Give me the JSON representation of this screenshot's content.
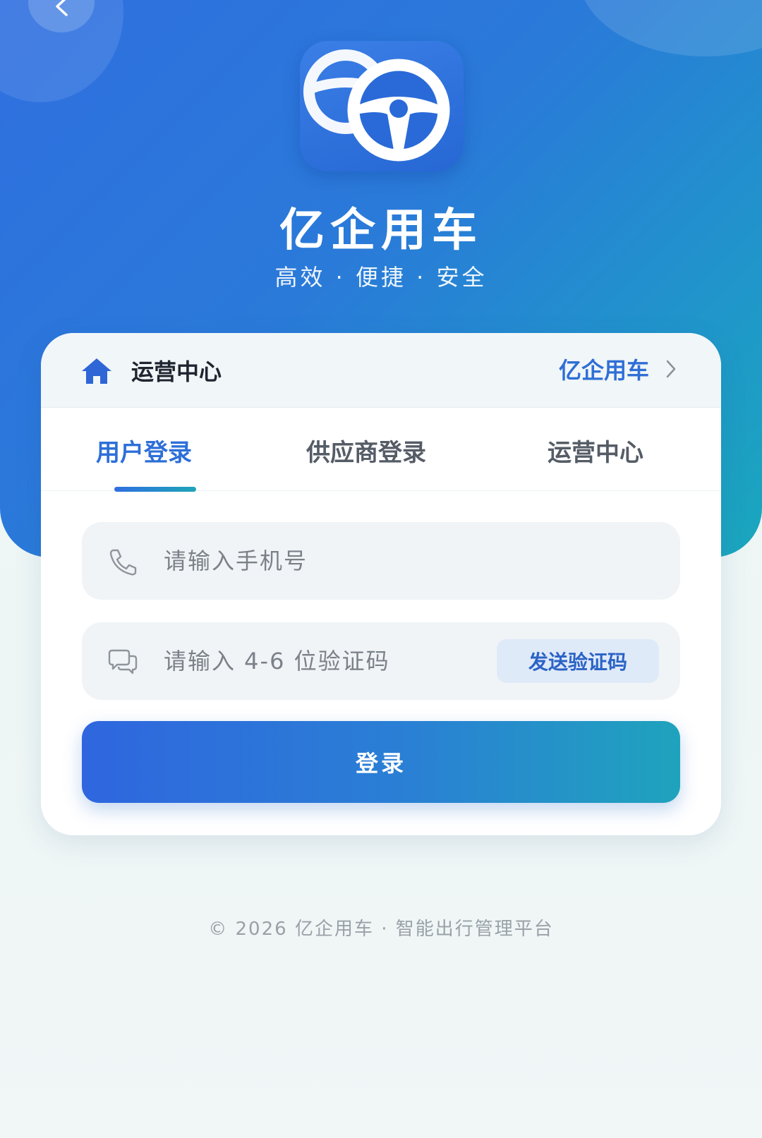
{
  "app": {
    "title": "亿企用车",
    "slogan": "高效 · 便捷 · 安全",
    "icon": "steering-wheel-icon"
  },
  "header": {
    "title": "运营中心",
    "link_label": "亿企用车",
    "home_icon": "home-icon"
  },
  "tabs": [
    {
      "label": "用户登录",
      "active": true
    },
    {
      "label": "供应商登录",
      "active": false
    },
    {
      "label": "运营中心",
      "active": false
    }
  ],
  "form": {
    "phone_placeholder": "请输入手机号",
    "code_placeholder": "请输入 4-6 位验证码",
    "send_code_label": "发送验证码",
    "login_label": "登录"
  },
  "footer": {
    "text": "© 2026 亿企用车 · 智能出行管理平台"
  },
  "colors": {
    "brand": "#2f6fe0",
    "accent": "#1fa5b8",
    "tab_active": "#2d6fd8"
  }
}
